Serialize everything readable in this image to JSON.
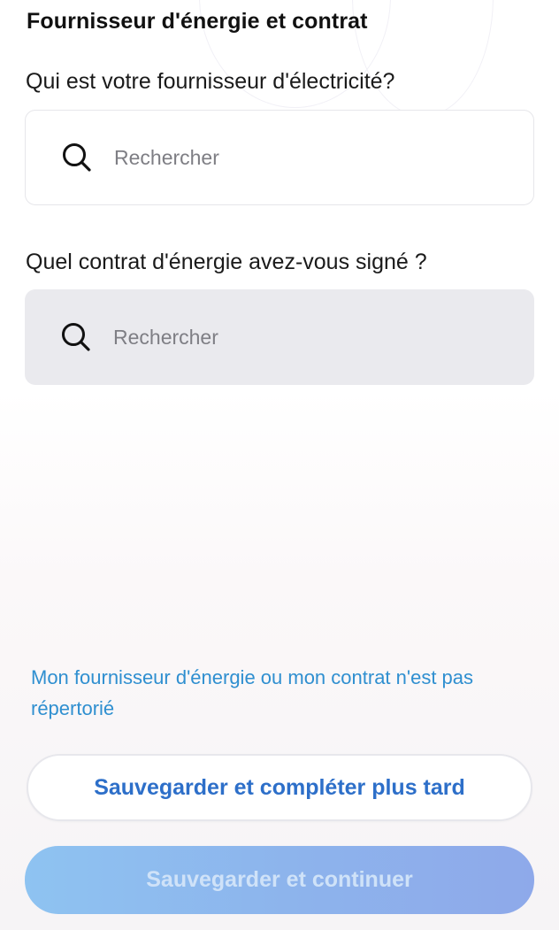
{
  "header": {
    "title": "Fournisseur d'énergie et contrat"
  },
  "supplier": {
    "question": "Qui est votre fournisseur d'électricité?",
    "search_placeholder": "Rechercher",
    "search_value": "",
    "icon": "search-icon"
  },
  "contract": {
    "question": "Quel contrat d'énergie avez-vous signé ?",
    "search_placeholder": "Rechercher",
    "search_value": "",
    "icon": "search-icon",
    "state": "disabled"
  },
  "not_listed_link": "Mon fournisseur d'énergie ou mon contrat n'est pas répertorié",
  "actions": {
    "save_later_label": "Sauvegarder et compléter plus tard",
    "save_continue_label": "Sauvegarder et continuer",
    "save_continue_state": "disabled"
  },
  "colors": {
    "link": "#2f8fd0",
    "secondary_button_text": "#2d6fc9",
    "primary_button_gradient_start": "#8ec3f1",
    "primary_button_gradient_end": "#8ea9ea",
    "disabled_field_background": "#eaeaee"
  }
}
